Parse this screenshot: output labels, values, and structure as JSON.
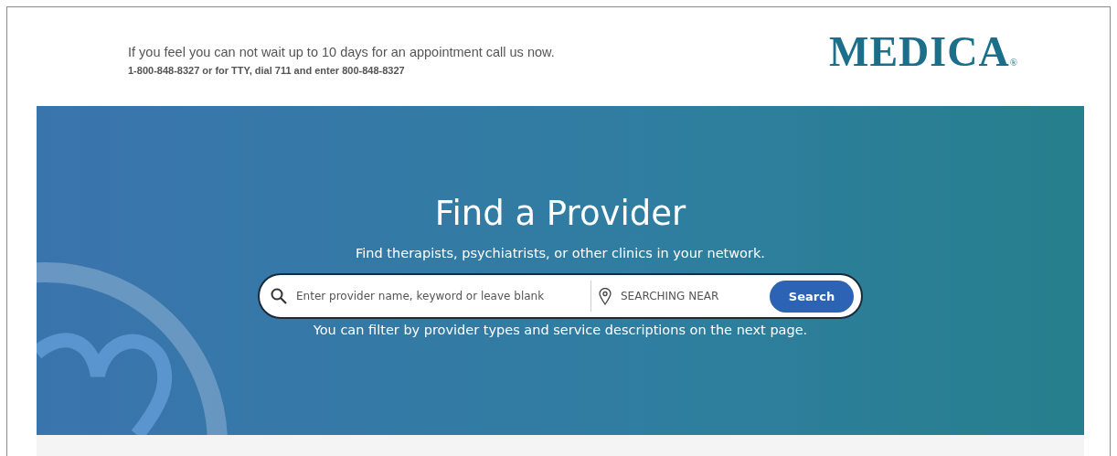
{
  "header": {
    "notice": "If you feel you can not wait up to 10 days for an appointment call us now.",
    "phone": "1-800-848-8327 or for TTY, dial 711 and enter 800-848-8327",
    "logo": "MEDICA$_{®}$"
  },
  "hero": {
    "title": "Find a Provider",
    "subtitle": "Find therapists, psychiatrists, or other clinics in your network.",
    "search": {
      "keyword_placeholder": "Enter provider name, keyword or leave blank",
      "location_placeholder": "SEARCHING NEAR",
      "button": "Search"
    },
    "hint": "You can filter by provider types and service descriptions on the next page."
  }
}
